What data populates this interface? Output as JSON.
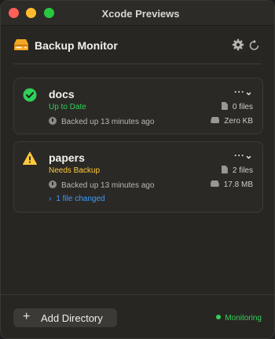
{
  "window": {
    "title": "Xcode Previews"
  },
  "header": {
    "title": "Backup Monitor",
    "app_icon": "drive-icon",
    "settings_icon": "gear-icon",
    "refresh_icon": "refresh-icon"
  },
  "directories": [
    {
      "name": "docs",
      "status": "Up to Date",
      "status_color": "#2fd159",
      "status_icon": "checkmark-circle-icon",
      "backed_up": "Backed up 13 minutes ago",
      "files": "0 files",
      "size": "Zero KB",
      "menu": "···⌄"
    },
    {
      "name": "papers",
      "status": "Needs Backup",
      "status_color": "#ffc93c",
      "status_icon": "warning-triangle-icon",
      "backed_up": "Backed up 13 minutes ago",
      "files": "2 files",
      "size": "17.8 MB",
      "changes": "1 file changed",
      "menu": "···⌄"
    }
  ],
  "footer": {
    "add_label": "Add Directory",
    "add_symbol": "+",
    "monitoring_label": "Monitoring",
    "monitoring_color": "#35d05a"
  }
}
